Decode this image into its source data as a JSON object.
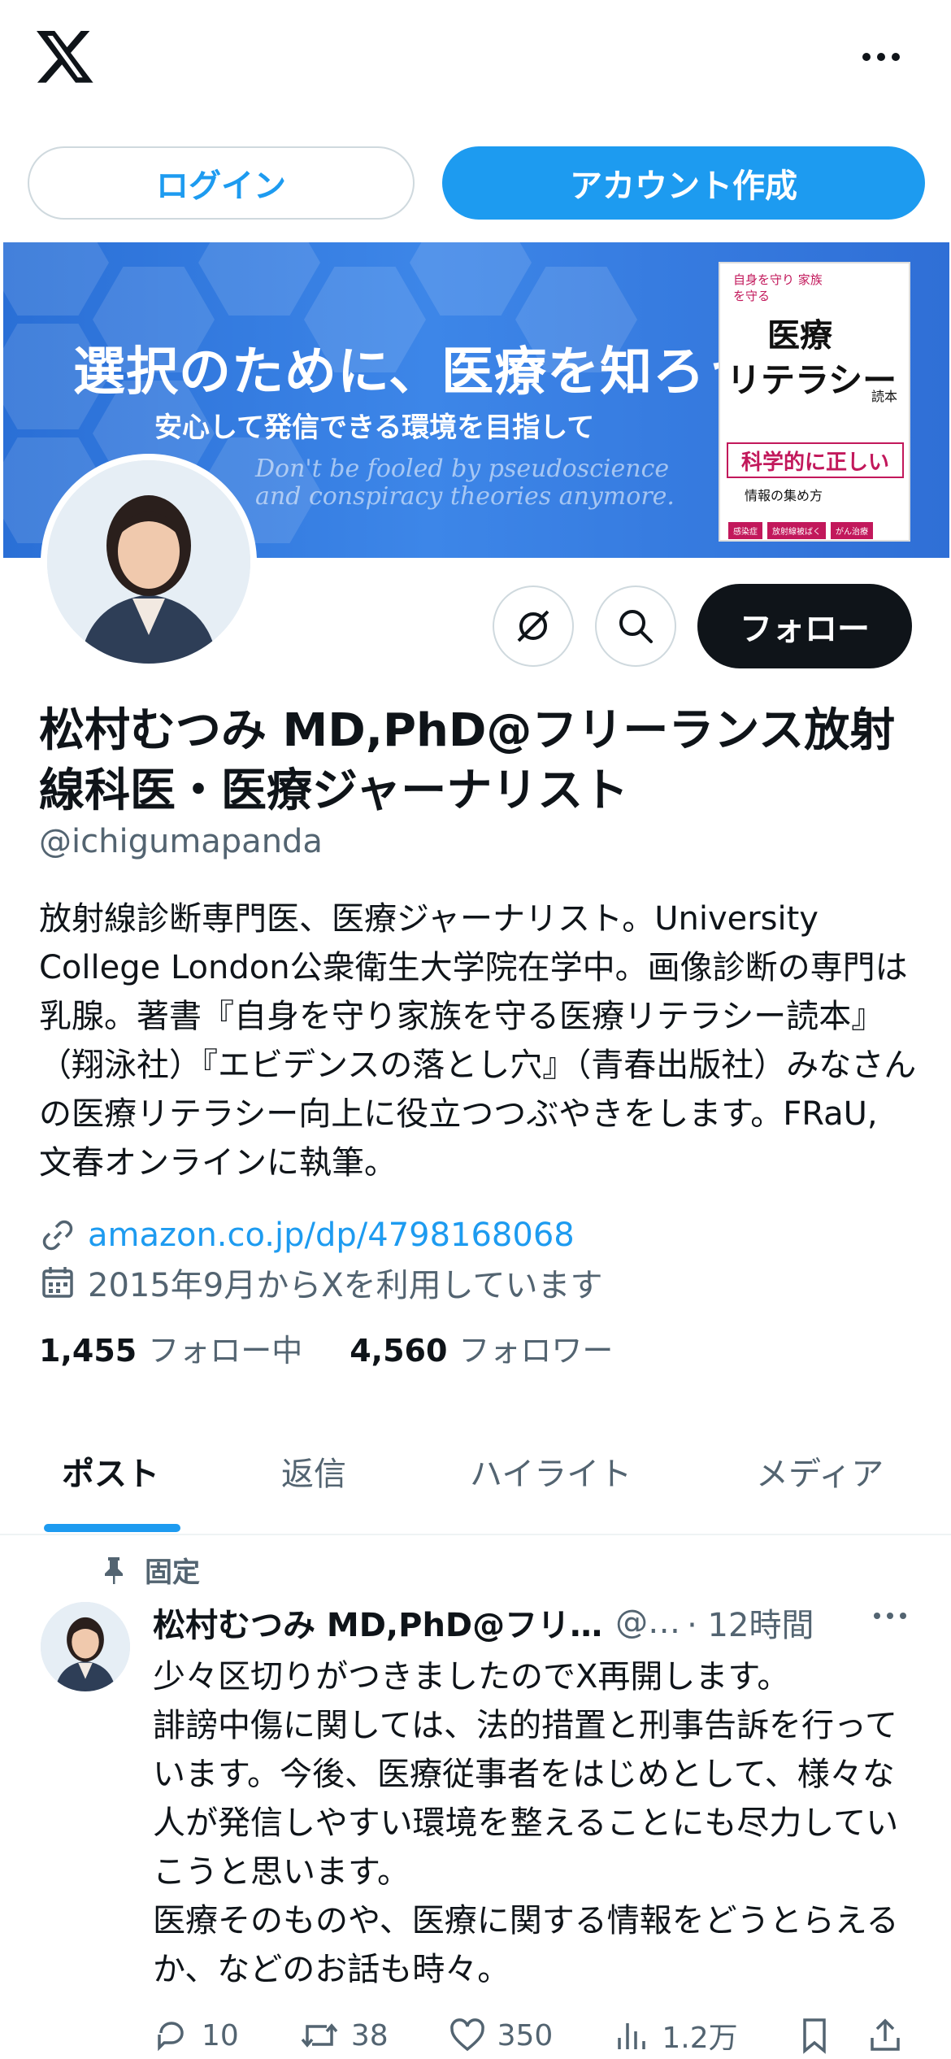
{
  "top": {
    "login_label": "ログイン",
    "signup_label": "アカウント作成"
  },
  "banner": {
    "headline": "選択のために、医療を知ろう",
    "subheadline": "安心して発信できる環境を目指して",
    "script_line1": "Don't be fooled by pseudoscience",
    "script_line2": "and conspiracy theories anymore.",
    "book": {
      "tagline": "自身を守り 家族を守る",
      "title1": "医療",
      "title2": "リテラシー",
      "title3": "読本",
      "band": "科学的に正しい",
      "caption": "情報の集め方",
      "tags": [
        "感染症",
        "放射線被ばく",
        "がん治療"
      ]
    }
  },
  "profile": {
    "follow_label": "フォロー",
    "name": "松村むつみ MD,PhD@フリーランス放射線科医・医療ジャーナリスト",
    "handle": "@ichigumapanda",
    "bio": "放射線診断専門医、医療ジャーナリスト。University College London公衆衛生大学院在学中。画像診断の専門は乳腺。著書『自身を守り家族を守る医療リテラシー読本』（翔泳社）『エビデンスの落とし穴』（青春出版社）みなさんの医療リテラシー向上に役立つつぶやきをします。FRaU, 文春オンラインに執筆。",
    "link": "amazon.co.jp/dp/4798168068",
    "joined": "2015年9月からXを利用しています",
    "following_count": "1,455",
    "following_label": "フォロー中",
    "followers_count": "4,560",
    "followers_label": "フォロワー"
  },
  "tabs": [
    "ポスト",
    "返信",
    "ハイライト",
    "メディア"
  ],
  "post": {
    "pinned_label": "固定",
    "author_name": "松村むつみ MD,PhD@フリ…",
    "author_handle": "@…",
    "time": "· 12時間",
    "text": "少々区切りがつきましたのでX再開します。\n誹謗中傷に関しては、法的措置と刑事告訴を行っています。今後、医療従事者をはじめとして、様々な人が発信しやすい環境を整えることにも尽力していこうと思います。\n医療そのものや、医療に関する情報をどうとらえるか、などのお話も時々。",
    "replies": "10",
    "reposts": "38",
    "likes": "350",
    "views": "1.2万"
  },
  "colors": {
    "accent": "#1d9bf0",
    "text": "#0f1419",
    "muted": "#536471"
  }
}
